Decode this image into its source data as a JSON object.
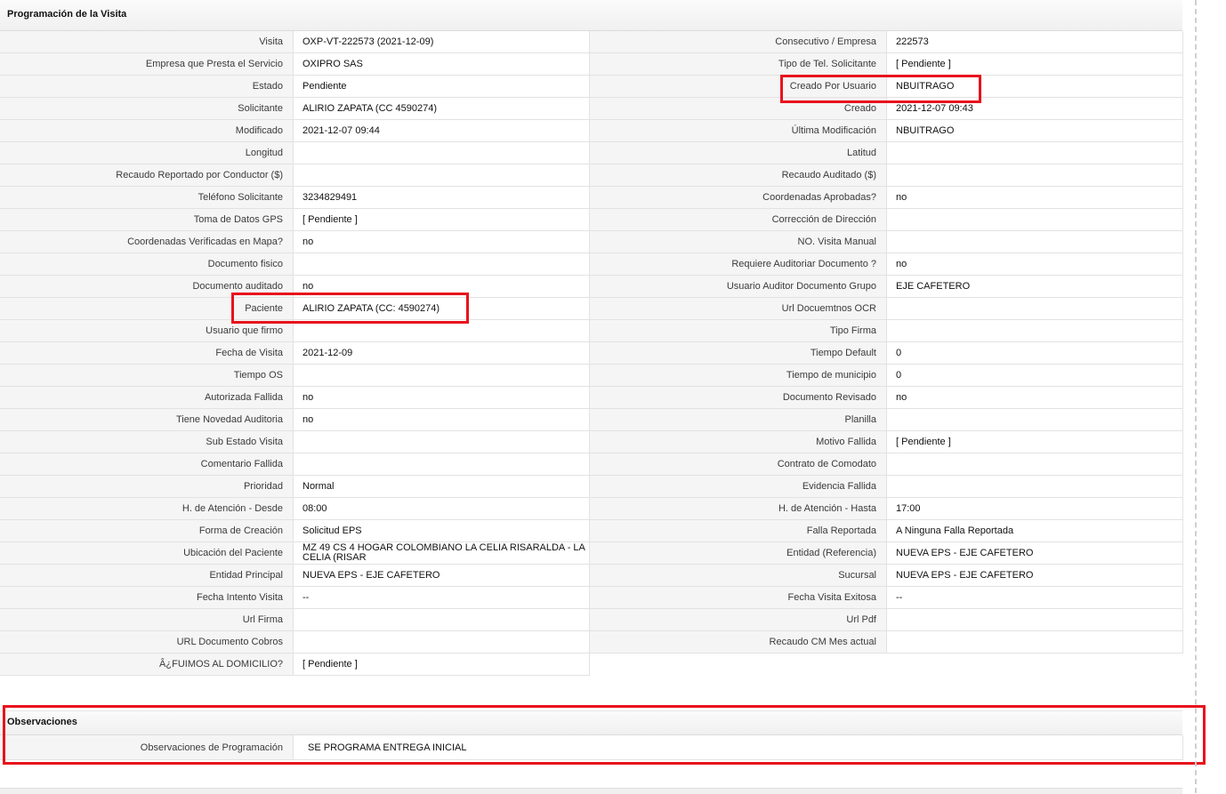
{
  "section": {
    "title": "Programación de la Visita",
    "observations_title": "Observaciones"
  },
  "rows": [
    [
      "Visita",
      "OXP-VT-222573 (2021-12-09)",
      "Consecutivo / Empresa",
      "222573"
    ],
    [
      "Empresa que Presta el Servicio",
      "OXIPRO SAS",
      "Tipo de Tel. Solicitante",
      "[ Pendiente ]"
    ],
    [
      "Estado",
      "Pendiente",
      "Creado Por Usuario",
      "NBUITRAGO"
    ],
    [
      "Solicitante",
      "ALIRIO ZAPATA (CC 4590274)",
      "Creado",
      "2021-12-07 09:43"
    ],
    [
      "Modificado",
      "2021-12-07 09:44",
      "Última Modificación",
      " NBUITRAGO"
    ],
    [
      "Longitud",
      "",
      "Latitud",
      ""
    ],
    [
      "Recaudo Reportado por Conductor ($)",
      "",
      "Recaudo Auditado ($)",
      ""
    ],
    [
      "Teléfono Solicitante",
      "3234829491",
      "Coordenadas Aprobadas?",
      " no"
    ],
    [
      "Toma de Datos GPS",
      "[ Pendiente ]",
      "Corrección de Dirección",
      ""
    ],
    [
      "Coordenadas Verificadas en Mapa?",
      " no",
      "NO. Visita Manual",
      ""
    ],
    [
      "Documento fisico",
      "",
      "Requiere Auditoriar Documento ?",
      " no"
    ],
    [
      "Documento auditado",
      " no",
      "Usuario Auditor Documento Grupo",
      "EJE CAFETERO"
    ],
    [
      "Paciente",
      "ALIRIO ZAPATA (CC: 4590274)",
      "Url Docuemtnos OCR",
      ""
    ],
    [
      "Usuario que firmo",
      "",
      "Tipo Firma",
      ""
    ],
    [
      "Fecha de Visita",
      " 2021-12-09",
      "Tiempo Default",
      "0"
    ],
    [
      "Tiempo OS",
      "",
      "Tiempo de municipio",
      "0"
    ],
    [
      "Autorizada Fallida",
      " no",
      "Documento Revisado",
      " no"
    ],
    [
      "Tiene Novedad Auditoria",
      " no",
      "Planilla",
      ""
    ],
    [
      "Sub Estado Visita",
      "",
      "Motivo Fallida",
      "[ Pendiente ]"
    ],
    [
      "Comentario Fallida",
      "",
      "Contrato de Comodato",
      ""
    ],
    [
      "Prioridad",
      "Normal",
      "Evidencia Fallida",
      ""
    ],
    [
      "H. de Atención - Desde",
      "08:00",
      "H. de Atención - Hasta",
      "17:00"
    ],
    [
      "Forma de Creación",
      "Solicitud EPS",
      "Falla Reportada",
      "A Ninguna Falla Reportada"
    ],
    [
      "Ubicación del Paciente",
      "MZ 49 CS 4 HOGAR COLOMBIANO LA CELIA RISARALDA - LA CELIA (RISAR",
      "Entidad (Referencia)",
      "NUEVA EPS - EJE CAFETERO"
    ],
    [
      "Entidad Principal",
      "NUEVA EPS - EJE CAFETERO",
      "Sucursal",
      "NUEVA EPS - EJE CAFETERO"
    ],
    [
      "Fecha Intento Visita",
      " --",
      "Fecha Visita Exitosa",
      " --"
    ],
    [
      "Url Firma",
      "",
      "Url Pdf",
      ""
    ],
    [
      "URL Documento Cobros",
      "",
      "Recaudo CM Mes actual",
      ""
    ],
    [
      "Â¿FUIMOS AL DOMICILIO?",
      "[ Pendiente ]",
      null,
      null
    ]
  ],
  "observations": {
    "label": "Observaciones de Programación",
    "value": "SE PROGRAMA ENTREGA INICIAL"
  },
  "highlight_color": "#e8121c"
}
